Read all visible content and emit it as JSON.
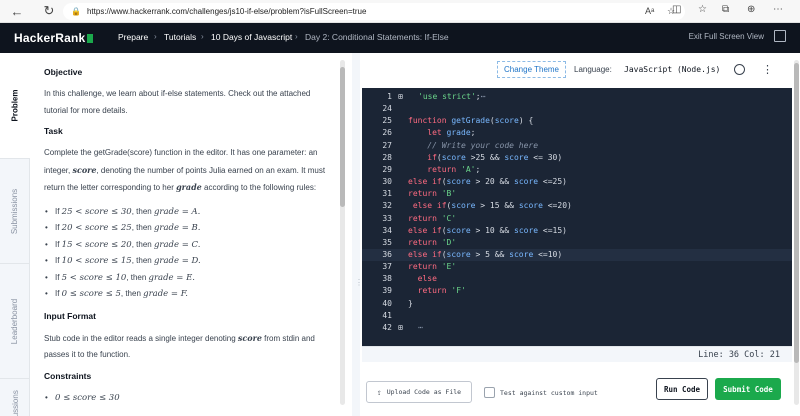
{
  "browser": {
    "url": "https://www.hackerrank.com/challenges/js10-if-else/problem?isFullScreen=true"
  },
  "header": {
    "logo": "HackerRank",
    "breadcrumbs": [
      "Prepare",
      "Tutorials",
      "10 Days of Javascript",
      "Day 2: Conditional Statements: If-Else"
    ],
    "exit_fullscreen": "Exit Full Screen View"
  },
  "tabs": [
    "Problem",
    "Submissions",
    "Leaderboard",
    "Discussions"
  ],
  "problem": {
    "objective_title": "Objective",
    "objective_text": "In this challenge, we learn about if-else statements. Check out the attached tutorial for more details.",
    "task_title": "Task",
    "task_p1_a": "Complete the ",
    "task_fn": "getGrade(score)",
    "task_p1_b": " function in the editor. It has one parameter: an integer, ",
    "task_var_score": "score",
    "task_p1_c": ", denoting the number of points Julia earned on an exam. It must return the letter corresponding to her ",
    "task_var_grade": "grade",
    "task_p1_d": " according to the following rules:",
    "rules": [
      {
        "prefix": "If ",
        "cond": "25 < score ≤ 30",
        "mid": ", then ",
        "res": "grade = A."
      },
      {
        "prefix": "If ",
        "cond": "20 < score ≤ 25",
        "mid": ", then ",
        "res": "grade = B."
      },
      {
        "prefix": "If ",
        "cond": "15 < score ≤ 20",
        "mid": ", then ",
        "res": "grade = C."
      },
      {
        "prefix": "If ",
        "cond": "10 < score ≤ 15",
        "mid": ", then ",
        "res": "grade = D."
      },
      {
        "prefix": "If ",
        "cond": "5 < score ≤ 10",
        "mid": ", then ",
        "res": "grade = E."
      },
      {
        "prefix": "If ",
        "cond": "0 ≤ score ≤ 5",
        "mid": ", then ",
        "res": "grade = F."
      }
    ],
    "input_title": "Input Format",
    "input_a": "Stub code in the editor reads a single integer denoting ",
    "input_var": "score",
    "input_b": " from stdin and passes it to the function.",
    "constraints_title": "Constraints",
    "constraint": "0 ≤ score ≤ 30"
  },
  "editor": {
    "change_theme": "Change Theme",
    "language_label": "Language:",
    "language": "JavaScript (Node.js)",
    "status": "Line: 36 Col: 21",
    "lines": [
      {
        "n": "1",
        "fold": "⊞",
        "html": "<span class=\"str\">'use strict'</span>;<span class=\"cm\">⋯</span>"
      },
      {
        "n": "24",
        "fold": "",
        "html": ""
      },
      {
        "n": "25",
        "fold": "",
        "html": "<span class=\"kw\">function</span> <span class=\"id\">getGrade</span>(<span class=\"id\">score</span>) {"
      },
      {
        "n": "26",
        "fold": "",
        "html": "    <span class=\"kw\">let</span> <span class=\"id\">grade</span>;"
      },
      {
        "n": "27",
        "fold": "",
        "html": "    <span class=\"cm\">// Write your code here</span>"
      },
      {
        "n": "28",
        "fold": "",
        "html": "    <span class=\"kw\">if</span>(<span class=\"id\">score</span> &gt;25 &amp;&amp; <span class=\"id\">score</span> &lt;= 30)"
      },
      {
        "n": "29",
        "fold": "",
        "html": "    <span class=\"kw\">return</span> <span class=\"str\">'A'</span>;"
      },
      {
        "n": "30",
        "fold": "",
        "html": "<span class=\"kw\">else if</span>(<span class=\"id\">score</span> &gt; 20 &amp;&amp; <span class=\"id\">score</span> &lt;=25)"
      },
      {
        "n": "31",
        "fold": "",
        "html": "<span class=\"kw\">return</span> <span class=\"str\">'B'</span>"
      },
      {
        "n": "32",
        "fold": "",
        "html": " <span class=\"kw\">else if</span>(<span class=\"id\">score</span> &gt; 15 &amp;&amp; <span class=\"id\">score</span> &lt;=20)"
      },
      {
        "n": "33",
        "fold": "",
        "html": "<span class=\"kw\">return</span> <span class=\"str\">'C'</span>"
      },
      {
        "n": "34",
        "fold": "",
        "html": "<span class=\"kw\">else if</span>(<span class=\"id\">score</span> &gt; 10 &amp;&amp; <span class=\"id\">score</span> &lt;=15)"
      },
      {
        "n": "35",
        "fold": "",
        "html": "<span class=\"kw\">return</span> <span class=\"str\">'D'</span>"
      },
      {
        "n": "36",
        "fold": "",
        "html": "<span class=\"kw\">else if</span>(<span class=\"id\">score</span> &gt; 5 &amp;&amp; <span class=\"id\">score</span> &lt;=10)"
      },
      {
        "n": "37",
        "fold": "",
        "html": "<span class=\"kw\">return</span> <span class=\"str\">'E'</span>"
      },
      {
        "n": "38",
        "fold": "",
        "html": "  <span class=\"kw\">else</span>"
      },
      {
        "n": "39",
        "fold": "",
        "html": "  <span class=\"kw\">return</span> <span class=\"str\">'F'</span>"
      },
      {
        "n": "40",
        "fold": "",
        "html": "}"
      },
      {
        "n": "41",
        "fold": "",
        "html": ""
      },
      {
        "n": "42",
        "fold": "⊞",
        "html": "<span class=\"cm\">⋯</span>"
      }
    ]
  },
  "bottom": {
    "upload": "Upload Code as File",
    "custom_input": "Test against custom input",
    "run": "Run Code",
    "submit": "Submit Code"
  }
}
